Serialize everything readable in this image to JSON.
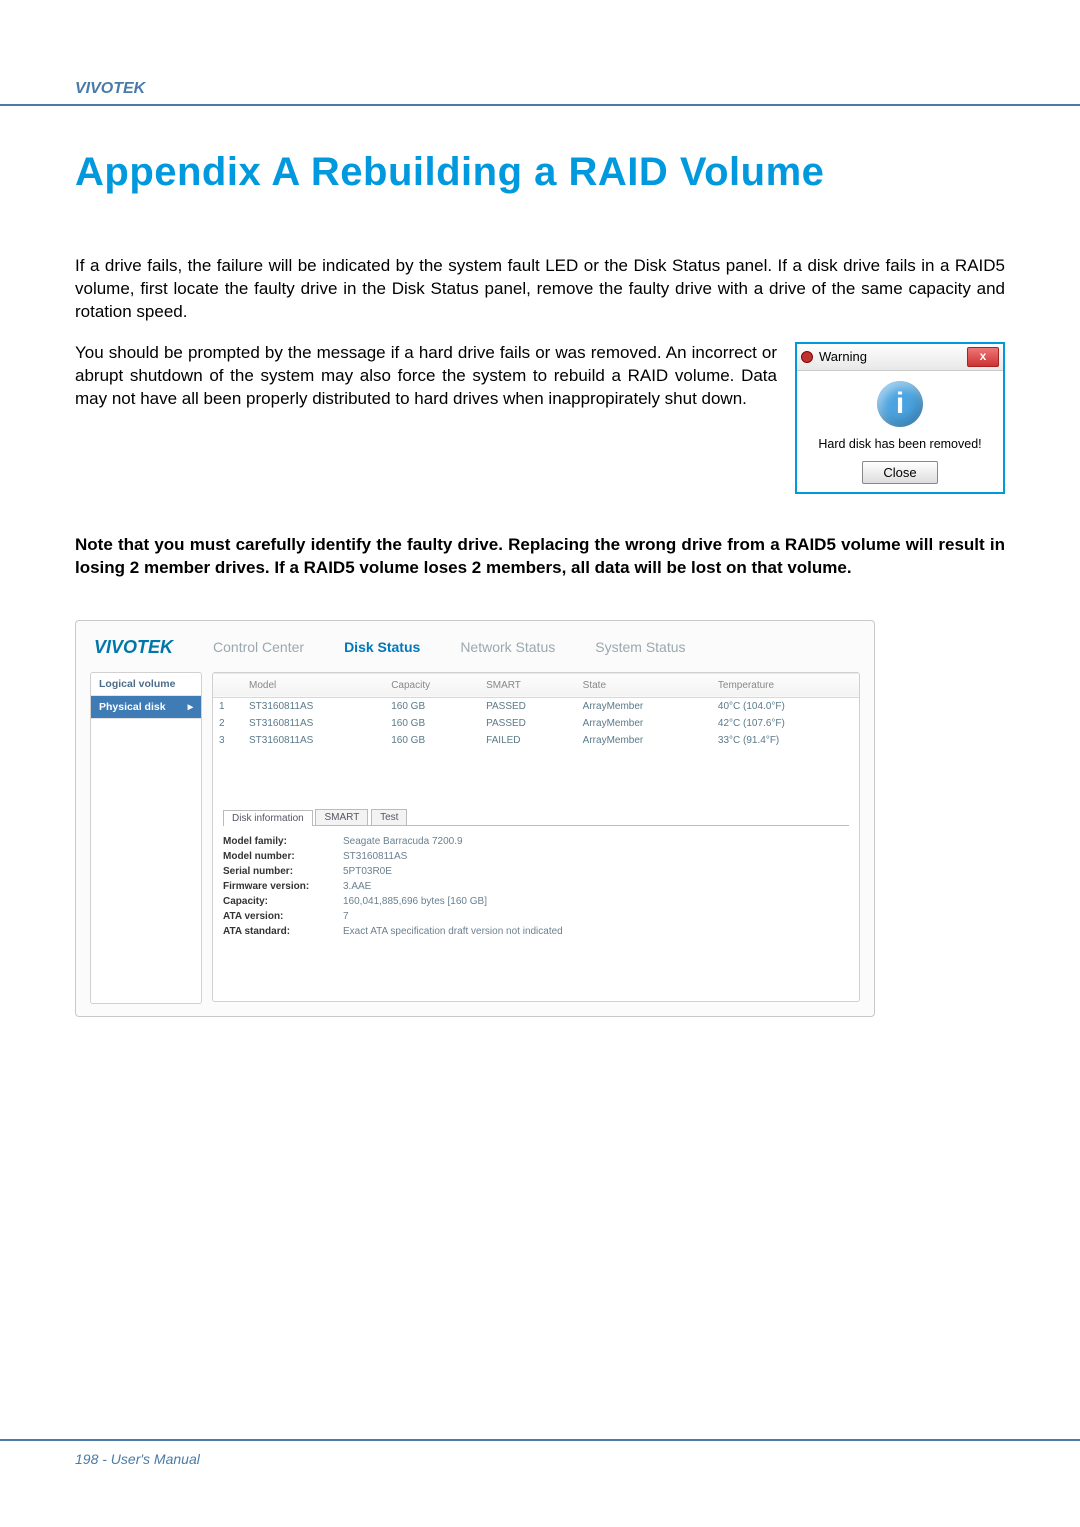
{
  "header": {
    "brand": "VIVOTEK"
  },
  "title": "Appendix A Rebuilding a RAID Volume",
  "para1": "If a drive fails, the failure will be indicated by the system fault LED or the Disk Status panel. If a disk drive fails in a RAID5 volume, first locate the faulty drive in the Disk Status panel, remove the faulty drive with a drive of the same capacity and rotation speed.",
  "para2": "You should be prompted by the message if a hard drive fails or was removed. An incorrect or abrupt shutdown of the system may also force the system to rebuild a RAID volume. Data may not have all been properly distributed to hard drives when inappropirately shut down.",
  "note": "Note that you must carefully identify the faulty drive. Replacing the wrong drive from a RAID5 volume will result in losing 2 member drives. If a RAID5 volume loses 2 members, all data will be lost on that volume.",
  "dialog": {
    "title": "Warning",
    "close_x": "x",
    "message": "Hard disk has been removed!",
    "close_btn": "Close"
  },
  "app": {
    "logo": "VIVOTEK",
    "tabs": {
      "control": "Control Center",
      "disk": "Disk Status",
      "network": "Network Status",
      "system": "System Status"
    },
    "side": {
      "logical": "Logical volume",
      "physical": "Physical disk"
    },
    "cols": {
      "idx": "",
      "model": "Model",
      "capacity": "Capacity",
      "smart": "SMART",
      "state": "State",
      "temp": "Temperature"
    },
    "rows": [
      {
        "idx": "1",
        "model": "ST3160811AS",
        "capacity": "160 GB",
        "smart": "PASSED",
        "state": "ArrayMember",
        "temp": "40°C (104.0°F)"
      },
      {
        "idx": "2",
        "model": "ST3160811AS",
        "capacity": "160 GB",
        "smart": "PASSED",
        "state": "ArrayMember",
        "temp": "42°C (107.6°F)"
      },
      {
        "idx": "3",
        "model": "ST3160811AS",
        "capacity": "160 GB",
        "smart": "FAILED",
        "state": "ArrayMember",
        "temp": "33°C (91.4°F)"
      }
    ],
    "subtabs": {
      "info": "Disk information",
      "smart": "SMART",
      "test": "Test"
    },
    "info": [
      {
        "lab": "Model family:",
        "val": "Seagate Barracuda 7200.9"
      },
      {
        "lab": "Model number:",
        "val": "ST3160811AS"
      },
      {
        "lab": "Serial number:",
        "val": "5PT03R0E"
      },
      {
        "lab": "Firmware version:",
        "val": "3.AAE"
      },
      {
        "lab": "Capacity:",
        "val": "160,041,885,696 bytes [160 GB]"
      },
      {
        "lab": "ATA version:",
        "val": "7"
      },
      {
        "lab": "ATA standard:",
        "val": "Exact ATA specification draft version not indicated"
      }
    ]
  },
  "footer": "198 - User's Manual"
}
